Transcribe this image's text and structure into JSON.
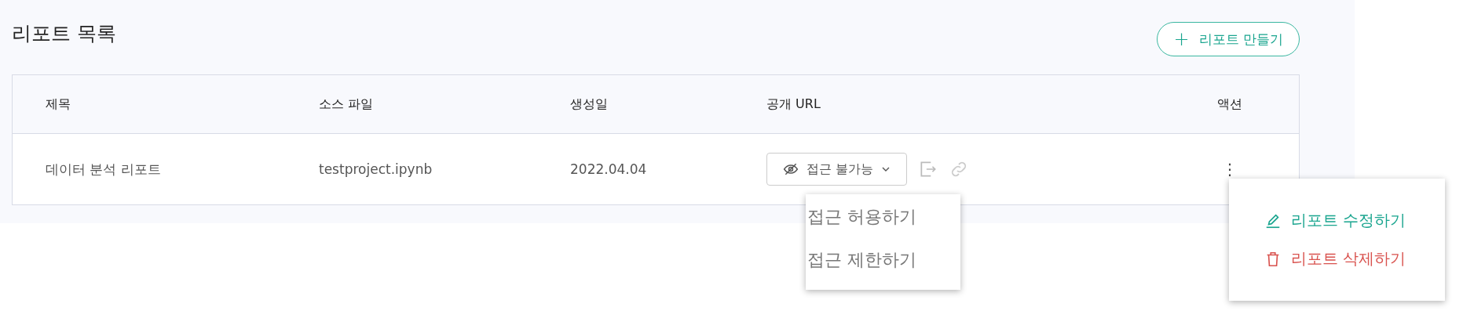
{
  "title": "리포트 목록",
  "create_button": {
    "icon": "+",
    "label": "리포트 만들기"
  },
  "table": {
    "columns": [
      "제목",
      "소스 파일",
      "생성일",
      "공개 URL",
      "액션"
    ],
    "rows": [
      {
        "title": "데이터 분석 리포트",
        "source_file": "testproject.ipynb",
        "created": "2022.04.04",
        "access": "접근 불가능",
        "actions_icon": "⋮"
      }
    ]
  },
  "access_menu": {
    "items": [
      {
        "label": "접근 허용하기"
      },
      {
        "label": "접근 제한하기"
      }
    ]
  },
  "action_menu": {
    "items": [
      {
        "kind": "edit",
        "label": "리포트 수정하기"
      },
      {
        "kind": "delete",
        "label": "리포트 삭제하기"
      }
    ]
  }
}
